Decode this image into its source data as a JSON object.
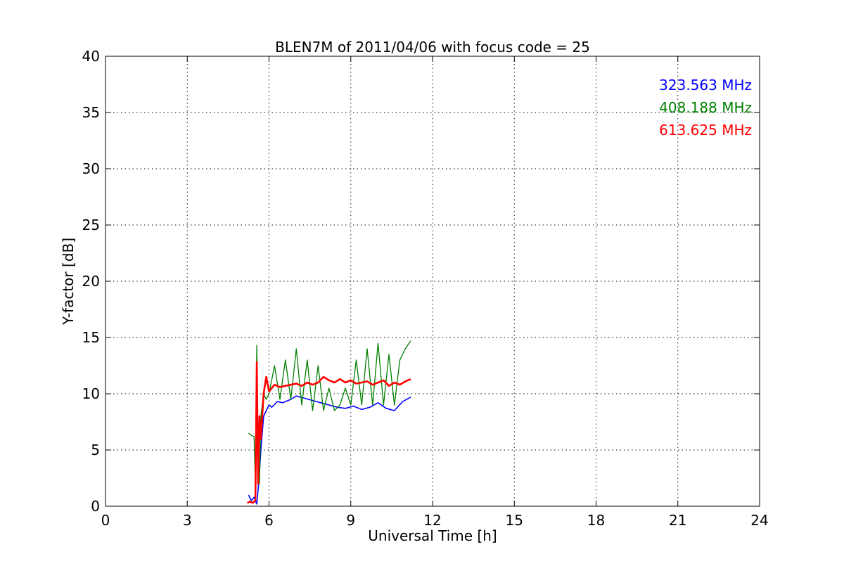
{
  "chart_data": {
    "type": "line",
    "title": "BLEN7M of 2011/04/06 with focus code = 25",
    "xlabel": "Universal Time [h]",
    "ylabel": "Y-factor [dB]",
    "xlim": [
      0,
      24
    ],
    "ylim": [
      0,
      40
    ],
    "xticks": [
      0,
      3,
      6,
      9,
      12,
      15,
      18,
      21,
      24
    ],
    "yticks": [
      0,
      5,
      10,
      15,
      20,
      25,
      30,
      35,
      40
    ],
    "grid": true,
    "legend_position": "top-right",
    "series": [
      {
        "name": "323.563 MHz",
        "color": "#0000ff",
        "x": [
          5.25,
          5.35,
          5.45,
          5.55,
          5.6,
          5.65,
          5.7,
          5.75,
          5.8,
          5.9,
          6.0,
          6.1,
          6.3,
          6.5,
          6.8,
          7.0,
          7.3,
          7.6,
          7.9,
          8.2,
          8.5,
          8.8,
          9.1,
          9.4,
          9.7,
          10.0,
          10.3,
          10.6,
          10.9,
          11.2
        ],
        "values": [
          1.0,
          0.5,
          0.8,
          0.2,
          1.5,
          3.0,
          5.0,
          6.5,
          8.0,
          8.5,
          9.0,
          8.8,
          9.3,
          9.2,
          9.5,
          9.8,
          9.6,
          9.4,
          9.2,
          9.0,
          8.8,
          8.7,
          8.9,
          8.6,
          8.8,
          9.2,
          8.7,
          8.5,
          9.3,
          9.7
        ]
      },
      {
        "name": "408.188 MHz",
        "color": "#008000",
        "x": [
          5.25,
          5.35,
          5.45,
          5.5,
          5.55,
          5.6,
          5.65,
          5.7,
          5.8,
          5.9,
          6.0,
          6.2,
          6.4,
          6.6,
          6.8,
          7.0,
          7.2,
          7.4,
          7.6,
          7.8,
          8.0,
          8.2,
          8.4,
          8.6,
          8.8,
          9.0,
          9.2,
          9.4,
          9.6,
          9.8,
          10.0,
          10.2,
          10.4,
          10.6,
          10.8,
          11.0,
          11.2
        ],
        "values": [
          6.5,
          6.3,
          6.2,
          2.0,
          14.3,
          4.0,
          2.0,
          8.0,
          10.0,
          9.5,
          10.0,
          12.5,
          9.5,
          13.0,
          9.5,
          14.0,
          9.0,
          13.0,
          8.5,
          12.5,
          8.5,
          10.5,
          8.5,
          9.0,
          10.5,
          9.0,
          13.0,
          9.0,
          14.0,
          9.0,
          14.5,
          9.0,
          13.5,
          9.0,
          13.0,
          14.0,
          14.7
        ]
      },
      {
        "name": "613.625 MHz",
        "color": "#ff0000",
        "x": [
          5.2,
          5.3,
          5.4,
          5.5,
          5.55,
          5.6,
          5.65,
          5.7,
          5.8,
          5.9,
          6.0,
          6.2,
          6.4,
          6.6,
          6.8,
          7.0,
          7.2,
          7.4,
          7.6,
          7.8,
          8.0,
          8.2,
          8.4,
          8.6,
          8.8,
          9.0,
          9.2,
          9.4,
          9.6,
          9.8,
          10.0,
          10.2,
          10.4,
          10.6,
          10.8,
          11.0,
          11.2
        ],
        "values": [
          0.3,
          0.4,
          0.3,
          0.5,
          12.8,
          2.0,
          8.0,
          6.0,
          10.0,
          11.5,
          10.2,
          10.8,
          10.6,
          10.7,
          10.8,
          10.9,
          10.7,
          11.0,
          10.8,
          11.0,
          11.5,
          11.2,
          11.0,
          11.3,
          11.0,
          11.2,
          10.9,
          11.0,
          11.1,
          10.8,
          11.0,
          11.2,
          10.7,
          11.0,
          10.8,
          11.1,
          11.3
        ]
      }
    ]
  }
}
